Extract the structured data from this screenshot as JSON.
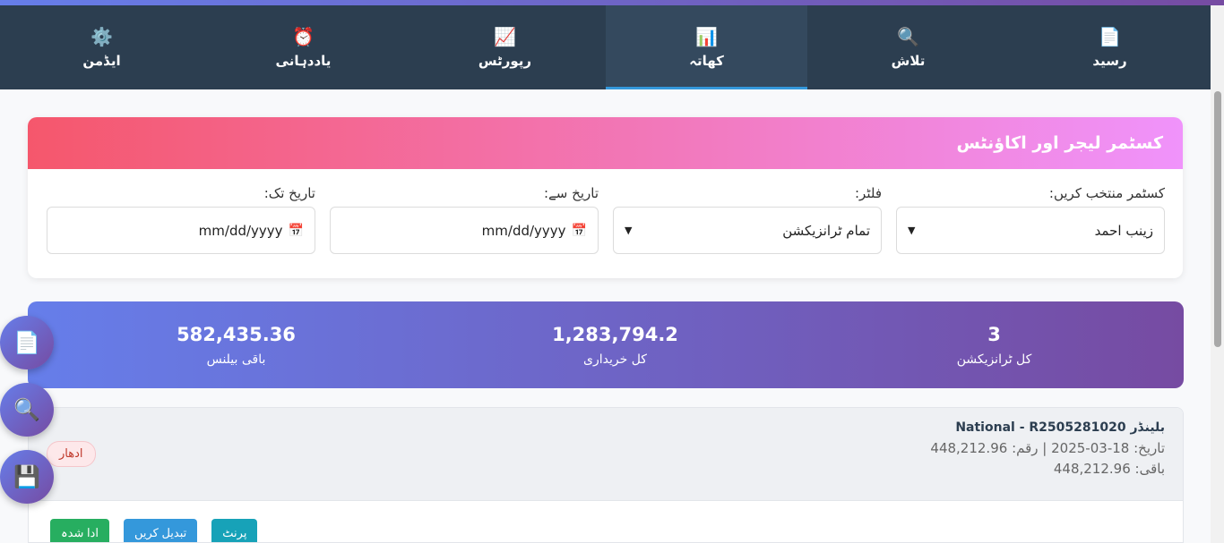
{
  "nav": {
    "tabs": [
      {
        "icon": "📄",
        "label": "رسید"
      },
      {
        "icon": "🔍",
        "label": "تلاش"
      },
      {
        "icon": "📊",
        "label": "کھاتہ"
      },
      {
        "icon": "📈",
        "label": "رپورٹس"
      },
      {
        "icon": "⏰",
        "label": "یاددہانی"
      },
      {
        "icon": "⚙️",
        "label": "ایڈمن"
      }
    ],
    "active_tab": "کھاتہ"
  },
  "ledger": {
    "title": "کسٹمر لیجر اور اکاؤنٹس",
    "customer": {
      "label": "کسٹمر منتخب کریں:",
      "value": "زینب احمد"
    },
    "filter": {
      "label": "فلٹر:",
      "value": "تمام ٹرانزیکشن"
    },
    "date_from": {
      "label": "تاریخ سے:",
      "placeholder": "mm/dd/yyyy"
    },
    "date_to": {
      "label": "تاریخ تک:",
      "placeholder": "mm/dd/yyyy"
    }
  },
  "summary": {
    "total_transactions": {
      "value": "3",
      "label": "کل ٹرانزیکشن"
    },
    "total_purchases": {
      "value": "1,283,794.2",
      "label": "کل خریداری"
    },
    "remaining_balance": {
      "value": "582,435.36",
      "label": "باقی بیلنس"
    }
  },
  "fabs": [
    {
      "icon": "📄",
      "name": "document"
    },
    {
      "icon": "🔍",
      "name": "search"
    },
    {
      "icon": "💾",
      "name": "save"
    }
  ],
  "transaction": {
    "title": "بلینڈر National - R2505281020",
    "meta": "تاریخ: 18-03-2025 | رقم: 448,212.96",
    "balance": "باقی: 448,212.96",
    "status_badge": "ادھار",
    "actions": {
      "print": "پرنٹ",
      "edit": "تبدیل کریں",
      "paid": "ادا شدہ"
    }
  },
  "colors": {
    "nav_bg": "#2c3e50",
    "nav_active": "#34495e",
    "header_gradient": [
      "#f093fb",
      "#f5576c"
    ],
    "summary_gradient": [
      "#667eea",
      "#764ba2"
    ],
    "paid_button": "#27ae60",
    "edit_button": "#3498db",
    "print_button": "#17a2b8"
  }
}
